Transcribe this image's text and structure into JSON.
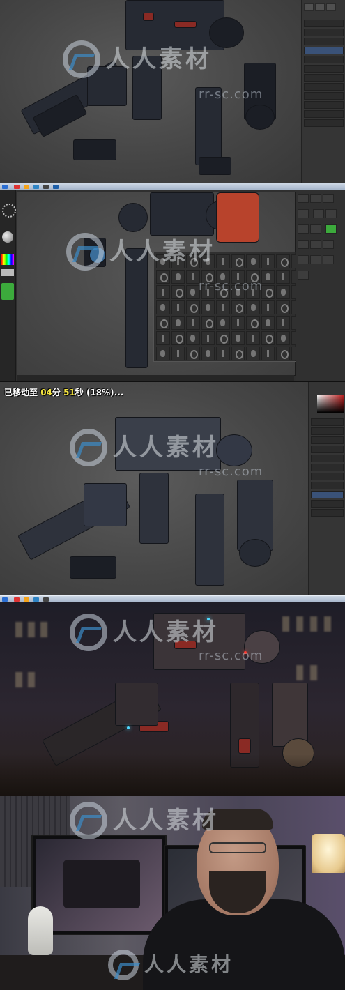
{
  "watermark": {
    "brand": "人人素材",
    "url": "rr-sc.com"
  },
  "progress_caption": {
    "prefix": "已移动至 ",
    "minutes": "04",
    "min_unit": "分 ",
    "seconds": "51",
    "sec_unit": "秒 ",
    "percent": "(18%)...",
    "progress_fraction": 0.18
  },
  "colors": {
    "photoshop_bg": "#4a4a4a",
    "zbrush_bg": "#2f2f2f",
    "accent_red": "#8a2a24",
    "caption_highlight": "#f3e340"
  },
  "icons": [
    "windows-start-icon",
    "zbrush-brush-palette",
    "color-picker",
    "layers-panel"
  ]
}
